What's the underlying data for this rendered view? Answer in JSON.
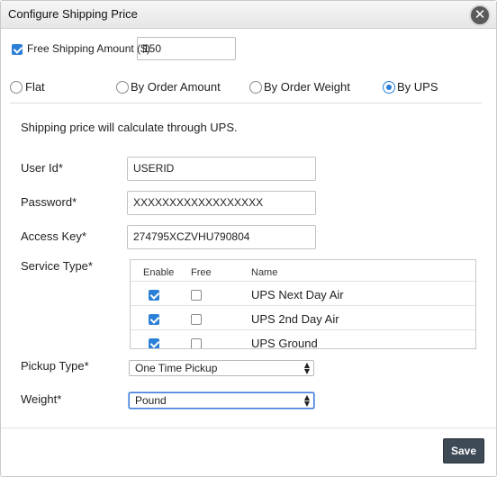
{
  "dialog": {
    "title": "Configure Shipping Price",
    "close_icon": "close-icon"
  },
  "free_shipping": {
    "checked": true,
    "label": "Free Shipping Amount ($)",
    "value": "150"
  },
  "methods": [
    {
      "label": "Flat",
      "selected": false
    },
    {
      "label": "By Order Amount",
      "selected": false
    },
    {
      "label": "By Order Weight",
      "selected": false
    },
    {
      "label": "By UPS",
      "selected": true
    }
  ],
  "info_text": "Shipping price will calculate through UPS.",
  "fields": {
    "user_id": {
      "label": "User Id*",
      "value": "USERID"
    },
    "password": {
      "label": "Password*",
      "value": "XXXXXXXXXXXXXXXXXX"
    },
    "access_key": {
      "label": "Access Key*",
      "value": "274795XCZVHU790804"
    }
  },
  "service_type": {
    "label": "Service Type*",
    "columns": {
      "enable": "Enable",
      "free": "Free",
      "name": "Name"
    },
    "rows": [
      {
        "enabled": true,
        "free": false,
        "name": "UPS Next Day Air"
      },
      {
        "enabled": true,
        "free": false,
        "name": "UPS 2nd Day Air"
      },
      {
        "enabled": true,
        "free": false,
        "name": "UPS Ground"
      }
    ]
  },
  "pickup_type": {
    "label": "Pickup Type*",
    "value": "One Time Pickup"
  },
  "weight": {
    "label": "Weight*",
    "value": "Pound"
  },
  "save_label": "Save"
}
